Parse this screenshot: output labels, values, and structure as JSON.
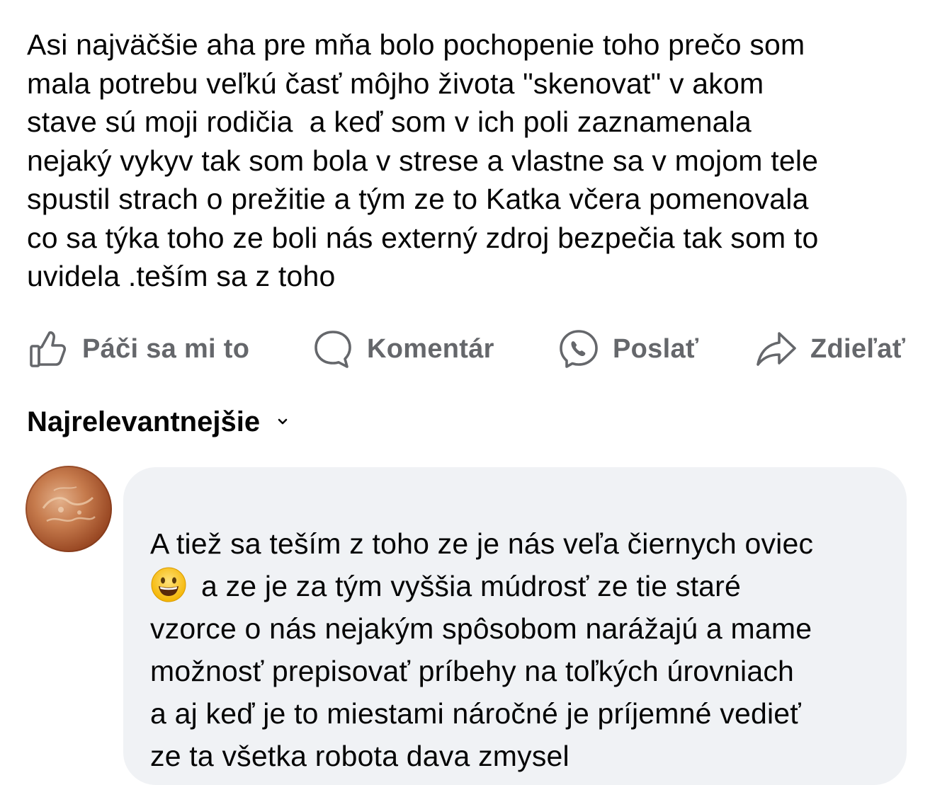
{
  "post": {
    "lines": [
      "Asi najväčšie aha pre mňa bolo pochopenie toho prečo som",
      "mala potrebu veľkú časť môjho života \"skenovat\" v akom",
      "stave sú moji rodičia  a keď som v ich poli zaznamenala",
      "nejaký vykyv tak som bola v strese a vlastne sa v mojom tele",
      "spustil strach o prežitie a tým ze to Katka včera pomenovala",
      "co sa týka toho ze boli nás externý zdroj bezpečia tak som to",
      "uvidela .teším sa z toho"
    ]
  },
  "actions": {
    "like": {
      "label": "Páči sa mi to",
      "icon": "thumbs-up-icon"
    },
    "comment": {
      "label": "Komentár",
      "icon": "comment-bubble-icon"
    },
    "send": {
      "label": "Poslať",
      "icon": "messenger-icon"
    },
    "share": {
      "label": "Zdieľať",
      "icon": "share-arrow-icon"
    },
    "label_color": "#65676b"
  },
  "comments": {
    "sort_label": "Najrelevantnejšie",
    "sort_icon": "chevron-down-icon",
    "items": [
      {
        "avatar": "user-avatar",
        "lines": [
          "A tiež sa teším z toho ze je nás veľa čiernych oviec",
          "a ze je za tým vyššia múdrosť ze tie staré",
          "vzorce o nás nejakým spôsobom narážajú a mame",
          "možnosť prepisovať príbehy na toľkých úrovniach",
          "a aj keď je to miestami náročné je príjemné vedieť",
          "ze ta všetka robota dava zmysel"
        ],
        "emoji": "grinning-face-emoji",
        "bubble_color": "#f0f2f5"
      }
    ]
  }
}
